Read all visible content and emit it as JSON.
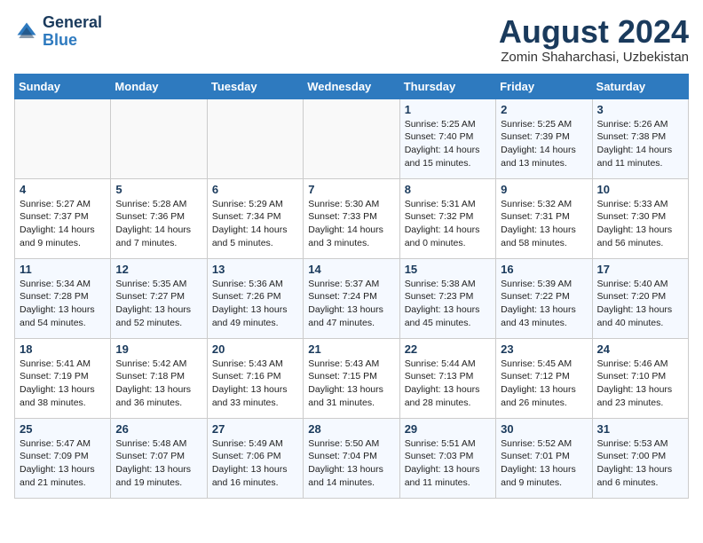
{
  "header": {
    "logo_line1": "General",
    "logo_line2": "Blue",
    "month_year": "August 2024",
    "location": "Zomin Shaharchasi, Uzbekistan"
  },
  "days_of_week": [
    "Sunday",
    "Monday",
    "Tuesday",
    "Wednesday",
    "Thursday",
    "Friday",
    "Saturday"
  ],
  "weeks": [
    [
      {
        "day": "",
        "info": ""
      },
      {
        "day": "",
        "info": ""
      },
      {
        "day": "",
        "info": ""
      },
      {
        "day": "",
        "info": ""
      },
      {
        "day": "1",
        "info": "Sunrise: 5:25 AM\nSunset: 7:40 PM\nDaylight: 14 hours\nand 15 minutes."
      },
      {
        "day": "2",
        "info": "Sunrise: 5:25 AM\nSunset: 7:39 PM\nDaylight: 14 hours\nand 13 minutes."
      },
      {
        "day": "3",
        "info": "Sunrise: 5:26 AM\nSunset: 7:38 PM\nDaylight: 14 hours\nand 11 minutes."
      }
    ],
    [
      {
        "day": "4",
        "info": "Sunrise: 5:27 AM\nSunset: 7:37 PM\nDaylight: 14 hours\nand 9 minutes."
      },
      {
        "day": "5",
        "info": "Sunrise: 5:28 AM\nSunset: 7:36 PM\nDaylight: 14 hours\nand 7 minutes."
      },
      {
        "day": "6",
        "info": "Sunrise: 5:29 AM\nSunset: 7:34 PM\nDaylight: 14 hours\nand 5 minutes."
      },
      {
        "day": "7",
        "info": "Sunrise: 5:30 AM\nSunset: 7:33 PM\nDaylight: 14 hours\nand 3 minutes."
      },
      {
        "day": "8",
        "info": "Sunrise: 5:31 AM\nSunset: 7:32 PM\nDaylight: 14 hours\nand 0 minutes."
      },
      {
        "day": "9",
        "info": "Sunrise: 5:32 AM\nSunset: 7:31 PM\nDaylight: 13 hours\nand 58 minutes."
      },
      {
        "day": "10",
        "info": "Sunrise: 5:33 AM\nSunset: 7:30 PM\nDaylight: 13 hours\nand 56 minutes."
      }
    ],
    [
      {
        "day": "11",
        "info": "Sunrise: 5:34 AM\nSunset: 7:28 PM\nDaylight: 13 hours\nand 54 minutes."
      },
      {
        "day": "12",
        "info": "Sunrise: 5:35 AM\nSunset: 7:27 PM\nDaylight: 13 hours\nand 52 minutes."
      },
      {
        "day": "13",
        "info": "Sunrise: 5:36 AM\nSunset: 7:26 PM\nDaylight: 13 hours\nand 49 minutes."
      },
      {
        "day": "14",
        "info": "Sunrise: 5:37 AM\nSunset: 7:24 PM\nDaylight: 13 hours\nand 47 minutes."
      },
      {
        "day": "15",
        "info": "Sunrise: 5:38 AM\nSunset: 7:23 PM\nDaylight: 13 hours\nand 45 minutes."
      },
      {
        "day": "16",
        "info": "Sunrise: 5:39 AM\nSunset: 7:22 PM\nDaylight: 13 hours\nand 43 minutes."
      },
      {
        "day": "17",
        "info": "Sunrise: 5:40 AM\nSunset: 7:20 PM\nDaylight: 13 hours\nand 40 minutes."
      }
    ],
    [
      {
        "day": "18",
        "info": "Sunrise: 5:41 AM\nSunset: 7:19 PM\nDaylight: 13 hours\nand 38 minutes."
      },
      {
        "day": "19",
        "info": "Sunrise: 5:42 AM\nSunset: 7:18 PM\nDaylight: 13 hours\nand 36 minutes."
      },
      {
        "day": "20",
        "info": "Sunrise: 5:43 AM\nSunset: 7:16 PM\nDaylight: 13 hours\nand 33 minutes."
      },
      {
        "day": "21",
        "info": "Sunrise: 5:43 AM\nSunset: 7:15 PM\nDaylight: 13 hours\nand 31 minutes."
      },
      {
        "day": "22",
        "info": "Sunrise: 5:44 AM\nSunset: 7:13 PM\nDaylight: 13 hours\nand 28 minutes."
      },
      {
        "day": "23",
        "info": "Sunrise: 5:45 AM\nSunset: 7:12 PM\nDaylight: 13 hours\nand 26 minutes."
      },
      {
        "day": "24",
        "info": "Sunrise: 5:46 AM\nSunset: 7:10 PM\nDaylight: 13 hours\nand 23 minutes."
      }
    ],
    [
      {
        "day": "25",
        "info": "Sunrise: 5:47 AM\nSunset: 7:09 PM\nDaylight: 13 hours\nand 21 minutes."
      },
      {
        "day": "26",
        "info": "Sunrise: 5:48 AM\nSunset: 7:07 PM\nDaylight: 13 hours\nand 19 minutes."
      },
      {
        "day": "27",
        "info": "Sunrise: 5:49 AM\nSunset: 7:06 PM\nDaylight: 13 hours\nand 16 minutes."
      },
      {
        "day": "28",
        "info": "Sunrise: 5:50 AM\nSunset: 7:04 PM\nDaylight: 13 hours\nand 14 minutes."
      },
      {
        "day": "29",
        "info": "Sunrise: 5:51 AM\nSunset: 7:03 PM\nDaylight: 13 hours\nand 11 minutes."
      },
      {
        "day": "30",
        "info": "Sunrise: 5:52 AM\nSunset: 7:01 PM\nDaylight: 13 hours\nand 9 minutes."
      },
      {
        "day": "31",
        "info": "Sunrise: 5:53 AM\nSunset: 7:00 PM\nDaylight: 13 hours\nand 6 minutes."
      }
    ]
  ]
}
